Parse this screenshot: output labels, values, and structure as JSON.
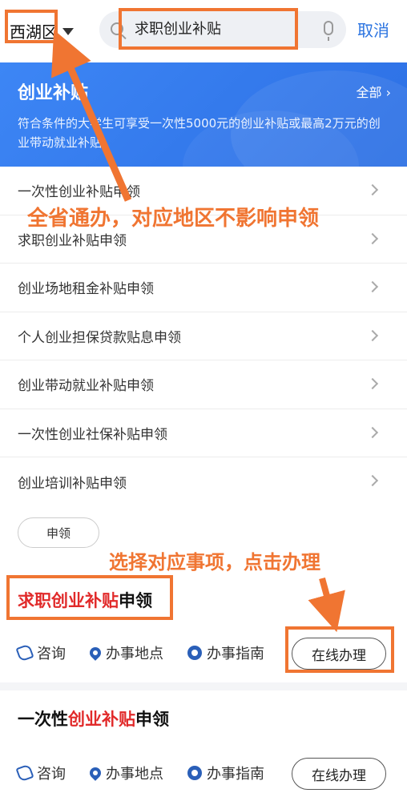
{
  "header": {
    "region": "西湖区",
    "search_value": "求职创业补贴",
    "cancel_label": "取消"
  },
  "banner": {
    "title": "创业补贴",
    "all_label": "全部 ›",
    "description": "符合条件的大学生可享受一次性5000元的创业补贴或最高2万元的创业带动就业补贴。"
  },
  "list": {
    "items": [
      "一次性创业补贴申领",
      "求职创业补贴申领",
      "创业场地租金补贴申领",
      "个人创业担保贷款贴息申领",
      "创业带动就业补贴申领",
      "一次性创业社保补贴申领",
      "创业培训补贴申领"
    ]
  },
  "filter": {
    "tag": "申领"
  },
  "results": [
    {
      "title_highlight": "求职创业补贴",
      "title_rest": "申领",
      "title_prefix": "",
      "actions": [
        "咨询",
        "办事地点",
        "办事指南"
      ],
      "button": "在线办理"
    },
    {
      "title_prefix": "一次性",
      "title_highlight": "创业补贴",
      "title_rest": "申领",
      "actions": [
        "咨询",
        "办事地点",
        "办事指南"
      ],
      "button": "在线办理"
    }
  ],
  "annotations": {
    "note1": "全省通办，对应地区不影响申领",
    "note2": "选择对应事项，点击办理",
    "color": "#f07532"
  },
  "colors": {
    "accent": "#2a73e0",
    "banner": "#3d86f5",
    "highlight": "#e12a2a"
  }
}
